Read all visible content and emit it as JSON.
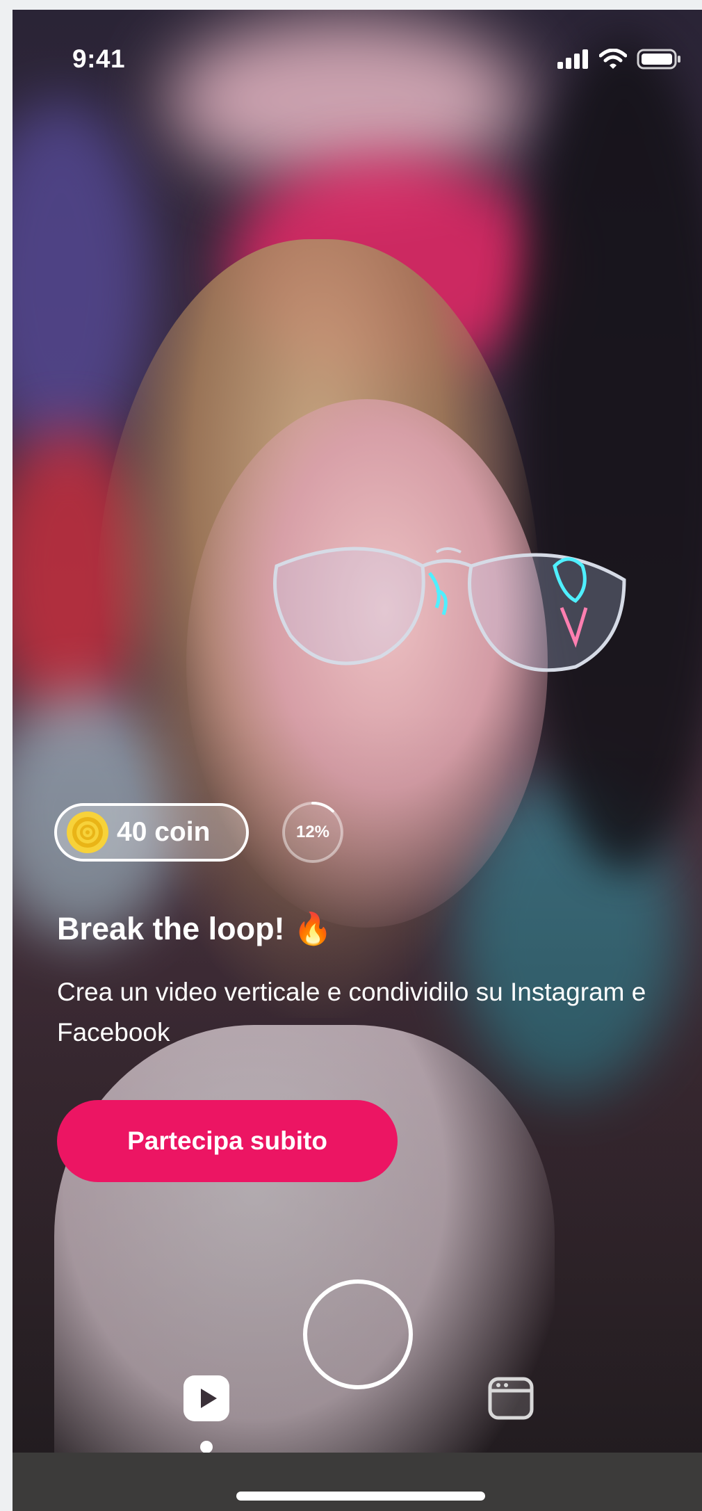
{
  "status_bar": {
    "time": "9:41",
    "icons": [
      "cellular-signal-icon",
      "wifi-icon",
      "battery-icon"
    ]
  },
  "challenge": {
    "coin_label": "40 coin",
    "coin_icon": "coin-icon",
    "progress_text": "12%",
    "progress_fraction": 0.12,
    "title": "Break the loop! 🔥",
    "description": "Crea un video verticale e condividilo su Instagram e Facebook",
    "cta_label": "Partecipa subito"
  },
  "bottom_nav": {
    "items": [
      {
        "name": "play-icon",
        "active": true
      },
      {
        "name": "record-button",
        "active": false
      },
      {
        "name": "gallery-icon",
        "active": false
      }
    ]
  },
  "colors": {
    "accent": "#EC1563",
    "coin_gold": "#F2C12E",
    "text": "#FFFFFF"
  }
}
